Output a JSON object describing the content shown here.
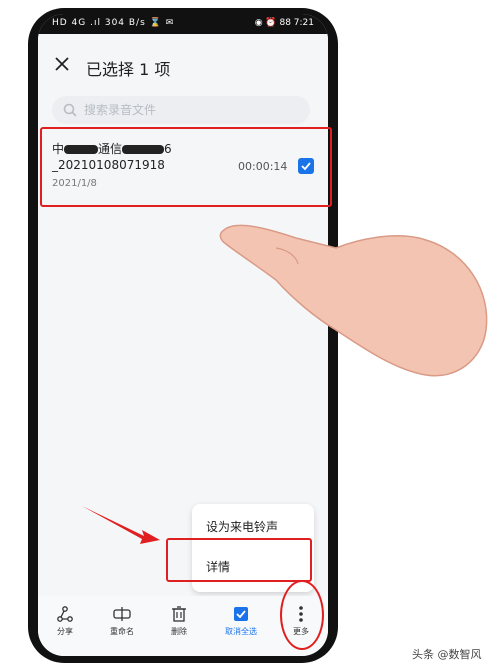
{
  "status_bar": {
    "left": "HD 4G .ıl 304 B/s ⌛ ✉",
    "right": "◉ ⏰ 88 7:21"
  },
  "header": {
    "title": "已选择 1 项"
  },
  "search": {
    "placeholder": "搜索录音文件"
  },
  "recording": {
    "title_start": "中",
    "title_mid": "通信",
    "title_end": "6",
    "subtitle": "_20210108071918",
    "date": "2021/1/8",
    "duration": "00:00:14",
    "selected": true
  },
  "context_menu": {
    "items": [
      "设为来电铃声",
      "详情"
    ]
  },
  "bottom_bar": {
    "items": [
      "分享",
      "重命名",
      "删除",
      "取消全选",
      "更多"
    ]
  },
  "watermark": "头条 @数智风",
  "colors": {
    "accent": "#1a73e8",
    "annotation": "#e02020"
  }
}
